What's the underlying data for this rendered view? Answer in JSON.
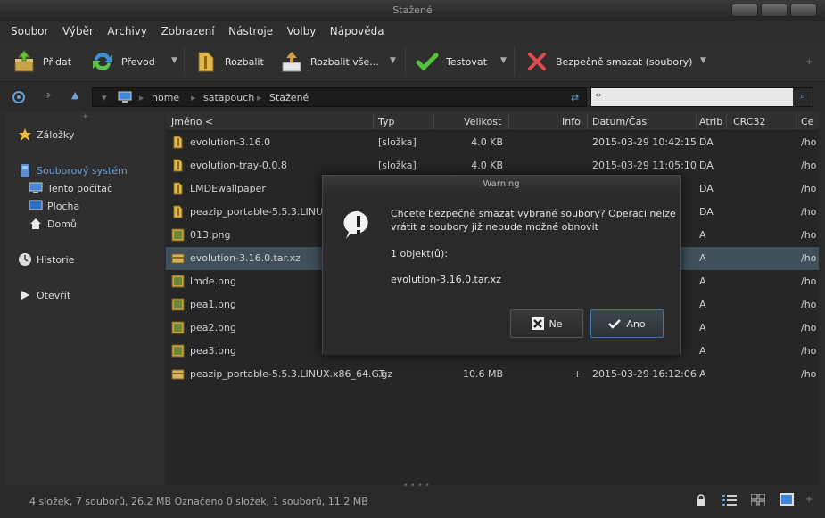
{
  "window": {
    "title": "Stažené"
  },
  "menu": [
    "Soubor",
    "Výběr",
    "Archivy",
    "Zobrazení",
    "Nástroje",
    "Volby",
    "Nápověda"
  ],
  "toolbar": {
    "add": "Přidat",
    "convert": "Převod",
    "extract": "Rozbalit",
    "extract_all": "Rozbalit vše...",
    "test": "Testovat",
    "secure_delete": "Bezpečně smazat (soubory)"
  },
  "address": {
    "segments": [
      "home",
      "satapouch",
      "Stažené"
    ],
    "search_value": "*"
  },
  "sidebar": {
    "bookmarks": "Záložky",
    "filesystem": "Souborový systém",
    "computer": "Tento počítač",
    "desktop": "Plocha",
    "home": "Domů",
    "history": "Historie",
    "open": "Otevřít"
  },
  "columns": [
    "Jméno <",
    "Typ",
    "Velikost",
    "Info",
    "Datum/Čas",
    "Atrib",
    "CRC32",
    "Ce"
  ],
  "files": [
    {
      "name": "evolution-3.16.0",
      "type": "[složka]",
      "size": "4.0 KB",
      "info": "",
      "date": "2015-03-29 10:42:15",
      "attr": "DA",
      "crc": "",
      "ce": "/ho",
      "icon": "folder"
    },
    {
      "name": "evolution-tray-0.0.8",
      "type": "[složka]",
      "size": "4.0 KB",
      "info": "",
      "date": "2015-03-29 11:05:10",
      "attr": "DA",
      "crc": "",
      "ce": "/ho",
      "icon": "folder"
    },
    {
      "name": "LMDEwallpaper",
      "type": "",
      "size": "",
      "info": "",
      "date": "",
      "attr": "DA",
      "crc": "",
      "ce": "/ho",
      "icon": "folder"
    },
    {
      "name": "peazip_portable-5.5.3.LINUX.",
      "type": "",
      "size": "",
      "info": "",
      "date": "",
      "attr": "DA",
      "crc": "",
      "ce": "/ho",
      "icon": "folder"
    },
    {
      "name": "013.png",
      "type": "",
      "size": "",
      "info": "",
      "date": "",
      "attr": "A",
      "crc": "",
      "ce": "/ho",
      "icon": "image"
    },
    {
      "name": "evolution-3.16.0.tar.xz",
      "type": "",
      "size": "",
      "info": "",
      "date": "",
      "attr": "A",
      "crc": "",
      "ce": "/ho",
      "icon": "archive"
    },
    {
      "name": "lmde.png",
      "type": "",
      "size": "",
      "info": "",
      "date": "",
      "attr": "A",
      "crc": "",
      "ce": "/ho",
      "icon": "image"
    },
    {
      "name": "pea1.png",
      "type": "",
      "size": "",
      "info": "",
      "date": "",
      "attr": "A",
      "crc": "",
      "ce": "/ho",
      "icon": "image"
    },
    {
      "name": "pea2.png",
      "type": "",
      "size": "",
      "info": "",
      "date": "",
      "attr": "A",
      "crc": "",
      "ce": "/ho",
      "icon": "image"
    },
    {
      "name": "pea3.png",
      "type": "",
      "size": "",
      "info": "",
      "date": "",
      "attr": "A",
      "crc": "",
      "ce": "/ho",
      "icon": "image"
    },
    {
      "name": "peazip_portable-5.5.3.LINUX.x86_64.GT",
      "type": ".gz",
      "size": "10.6 MB",
      "info": "+",
      "date": "2015-03-29 16:12:06",
      "attr": "A",
      "crc": "",
      "ce": "/ho",
      "icon": "archive"
    }
  ],
  "selected_row": 5,
  "status": {
    "text": "4 složek, 7 souborů, 26.2 MB   Označeno 0 složek, 1 souborů, 11.2 MB"
  },
  "dialog": {
    "title": "Warning",
    "message_line1": "Chcete bezpečně smazat vybrané soubory? Operaci nelze",
    "message_line2": "vrátit a soubory již nebude možné obnovit",
    "count": "1 objekt(ů):",
    "item": "evolution-3.16.0.tar.xz",
    "no": "Ne",
    "yes": "Ano"
  },
  "colors": {
    "selection": "#40505a",
    "accent": "#3c77b4"
  }
}
